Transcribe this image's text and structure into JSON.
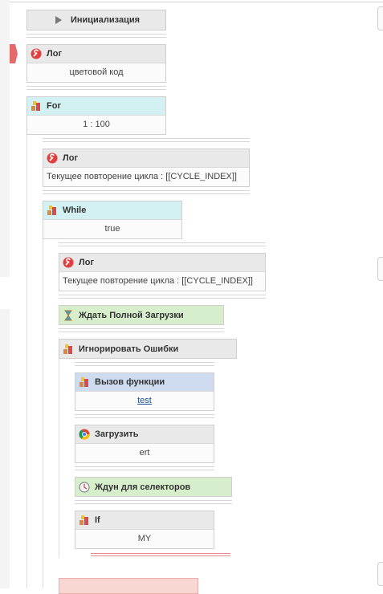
{
  "blocks": {
    "init": {
      "label": "Инициализация"
    },
    "log1": {
      "title": "Лог",
      "value": "цветовой код"
    },
    "for": {
      "title": "For",
      "value": "1 : 100"
    },
    "log2": {
      "title": "Лог",
      "value": "Текущее повторение цикла : [[CYCLE_INDEX]]"
    },
    "while": {
      "title": "While",
      "value": "true"
    },
    "log3": {
      "title": "Лог",
      "value": "Текущее повторение цикла : [[CYCLE_INDEX]]"
    },
    "wait_load": {
      "title": "Ждать Полной Загрузки"
    },
    "ignore_errors": {
      "title": "Игнорировать Ошибки"
    },
    "call_func": {
      "title": "Вызов функции",
      "value": "test"
    },
    "load": {
      "title": "Загрузить",
      "value": "ert"
    },
    "wait_selectors": {
      "title": "Ждун для селекторов"
    },
    "if": {
      "title": "If",
      "value": "MY"
    }
  },
  "colors": {
    "header_gray": "#e9e9e9",
    "header_cyan": "#d3f0f3",
    "header_green": "#d6eecb",
    "header_blue": "#cfdcef",
    "header_pink": "#f8d6d2",
    "accent_red": "#e36a6a"
  }
}
